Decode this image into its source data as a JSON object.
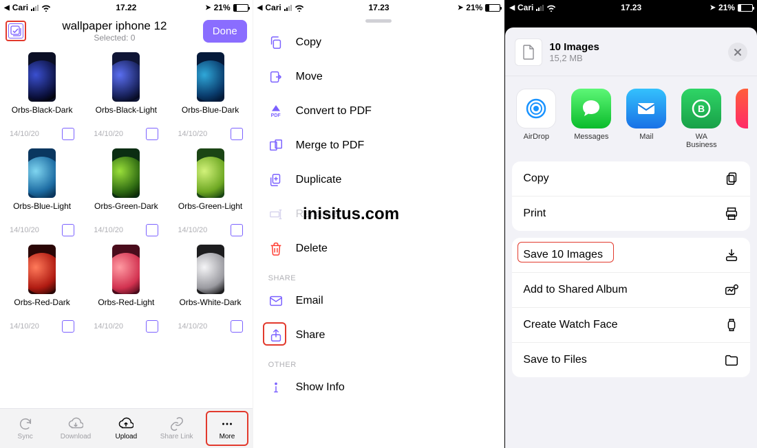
{
  "status": {
    "back_app": "Cari",
    "time_1": "17.22",
    "time_2": "17.23",
    "time_3": "17.23",
    "battery_pct": "21%"
  },
  "panel1": {
    "title": "wallpaper iphone 12",
    "subtitle": "Selected: 0",
    "done": "Done",
    "items": [
      {
        "name": "Orbs-Black-Dark",
        "date": "14/10/20",
        "bg": "#0b0f25",
        "orb": "radial-gradient(circle at 35% 35%, #3a4fcf, #0a0f3a 60%, #000 80%)"
      },
      {
        "name": "Orbs-Black-Light",
        "date": "14/10/20",
        "bg": "#101636",
        "orb": "radial-gradient(circle at 35% 35%, #5a6ef0, #1a2460 55%, #020514 80%)"
      },
      {
        "name": "Orbs-Blue-Dark",
        "date": "14/10/20",
        "bg": "#051a3a",
        "orb": "radial-gradient(circle at 35% 35%, #2fa7d8, #0a3d6e 55%, #01142f 80%)"
      },
      {
        "name": "Orbs-Blue-Light",
        "date": "14/10/20",
        "bg": "#0a3760",
        "orb": "radial-gradient(circle at 35% 35%, #7fd5f0, #1d6ca3 55%, #083254 80%)"
      },
      {
        "name": "Orbs-Green-Dark",
        "date": "14/10/20",
        "bg": "#0b2d12",
        "orb": "radial-gradient(circle at 35% 35%, #9adf3a, #2e6a12 55%, #0a2406 80%)"
      },
      {
        "name": "Orbs-Green-Light",
        "date": "14/10/20",
        "bg": "#1b4514",
        "orb": "radial-gradient(circle at 35% 35%, #d2f27a, #6ea823 55%, #1e4a10 80%)"
      },
      {
        "name": "Orbs-Red-Dark",
        "date": "14/10/20",
        "bg": "#2a0606",
        "orb": "radial-gradient(circle at 35% 35%, #ff7a5a, #b01b12 55%, #3a0705 80%)"
      },
      {
        "name": "Orbs-Red-Light",
        "date": "14/10/20",
        "bg": "#4a0c1c",
        "orb": "radial-gradient(circle at 35% 35%, #ff9aa2, #d23250 55%, #5a0e1f 80%)"
      },
      {
        "name": "Orbs-White-Dark",
        "date": "14/10/20",
        "bg": "#1d1d1f",
        "orb": "radial-gradient(circle at 35% 35%, #f5f5f7, #9a9aa0 55%, #1d1d1f 80%)"
      }
    ],
    "toolbar": {
      "sync": "Sync",
      "download": "Download",
      "upload": "Upload",
      "sharelink": "Share Link",
      "more": "More"
    }
  },
  "panel2": {
    "items": {
      "copy": "Copy",
      "move": "Move",
      "convert_pdf": "Convert to PDF",
      "merge_pdf": "Merge to PDF",
      "duplicate": "Duplicate",
      "rename": "Rename",
      "delete": "Delete",
      "email": "Email",
      "share": "Share",
      "show_info": "Show Info"
    },
    "section_share": "SHARE",
    "section_other": "OTHER",
    "pdf_label": "PDF"
  },
  "panel3": {
    "share_title": "10 Images",
    "share_size": "15,2 MB",
    "apps": {
      "airdrop": "AirDrop",
      "messages": "Messages",
      "mail": "Mail",
      "wabusiness": "WA Business"
    },
    "actions": {
      "copy": "Copy",
      "print": "Print",
      "save": "Save 10 Images",
      "add_shared": "Add to Shared Album",
      "watch_face": "Create Watch Face",
      "save_files": "Save to Files"
    }
  },
  "watermark": "inisitus.com"
}
